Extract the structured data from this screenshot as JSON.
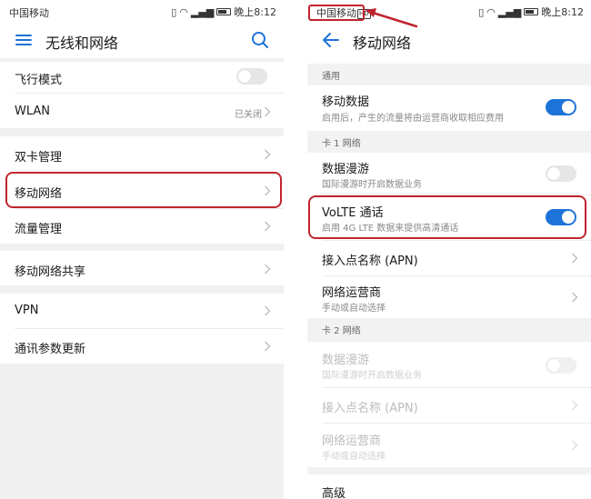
{
  "left_screen": {
    "status": {
      "carrier": "中国移动",
      "time_text": "晚上8:12"
    },
    "title": "无线和网络",
    "items": [
      {
        "label": "飞行模式"
      },
      {
        "label": "WLAN",
        "value": "已关闭"
      },
      {
        "label": "双卡管理"
      },
      {
        "label": "移动网络"
      },
      {
        "label": "流量管理"
      },
      {
        "label": "移动网络共享"
      },
      {
        "label": "VPN"
      },
      {
        "label": "通讯参数更新"
      }
    ]
  },
  "right_screen": {
    "status": {
      "carrier": "中国移动",
      "hd_badge": "HD",
      "time_text": "晚上8:12"
    },
    "title": "移动网络",
    "sections": [
      {
        "header": "通用"
      },
      {
        "header": "卡 1 网络"
      },
      {
        "header": "卡 2 网络"
      }
    ],
    "items": [
      {
        "label": "移动数据",
        "sub": "启用后，产生的流量将由运营商收取相应费用",
        "toggle": "on"
      },
      {
        "label": "数据漫游",
        "sub": "国际漫游时开启数据业务",
        "toggle": "off"
      },
      {
        "label": "VoLTE 通话",
        "sub": "启用 4G LTE 数据来提供高清通话",
        "toggle": "on"
      },
      {
        "label": "接入点名称 (APN)"
      },
      {
        "label": "网络运营商",
        "sub": "手动或自动选择"
      },
      {
        "label": "数据漫游",
        "sub": "国际漫游时开启数据业务",
        "toggle": "off",
        "disabled": true
      },
      {
        "label": "接入点名称 (APN)",
        "disabled": true
      },
      {
        "label": "网络运营商",
        "sub": "手动或自动选择",
        "disabled": true
      },
      {
        "label": "高级"
      }
    ]
  },
  "colors": {
    "toggle_on": "#1e73d8",
    "highlight": "#c0252f",
    "section_bg": "#f2f2f2"
  }
}
